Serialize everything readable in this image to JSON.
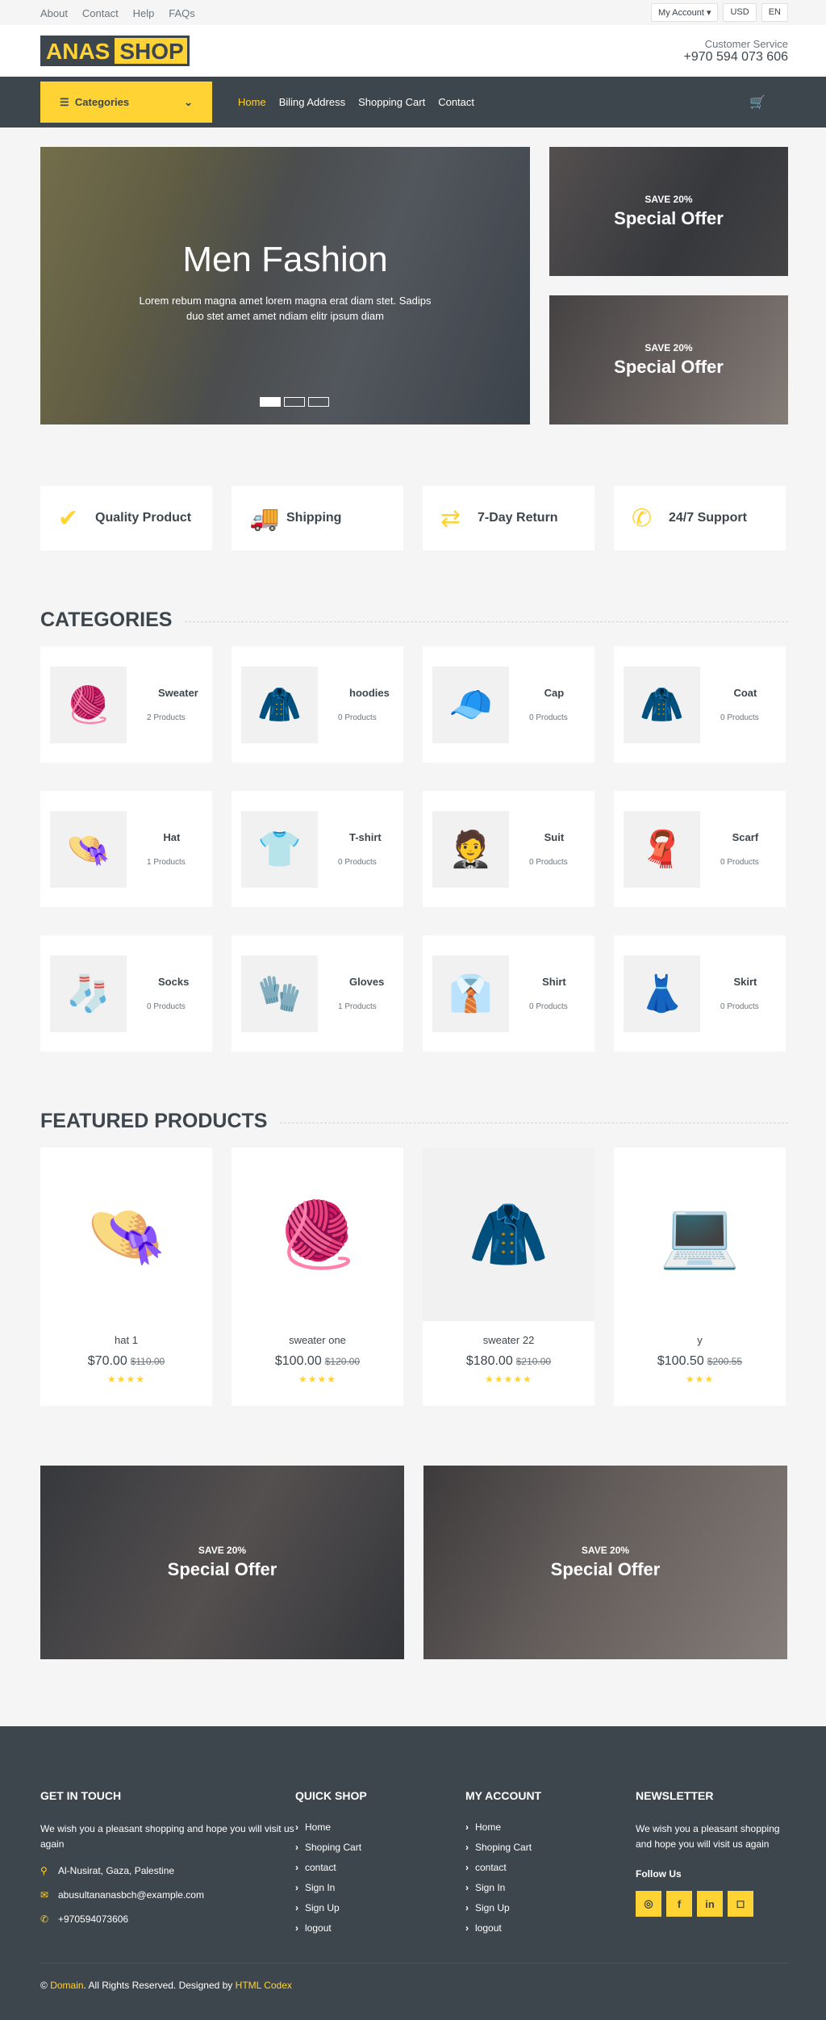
{
  "topbar": {
    "links": [
      "About",
      "Contact",
      "Help",
      "FAQs"
    ],
    "account": "My Account",
    "currency": "USD",
    "language": "EN"
  },
  "header": {
    "logo_a": "ANAS",
    "logo_b": "SHOP",
    "cs_label": "Customer Service",
    "cs_phone": "+970 594 073 606"
  },
  "nav": {
    "categories": "Categories",
    "links": [
      "Home",
      "Biling Address",
      "Shopping Cart",
      "Contact"
    ]
  },
  "hero": {
    "title": "Men Fashion",
    "text": "Lorem rebum magna amet lorem magna erat diam stet. Sadips duo stet amet amet ndiam elitr ipsum diam",
    "offer_save": "SAVE 20%",
    "offer_title": "Special Offer"
  },
  "features": [
    "Quality Product",
    "Shipping",
    "7-Day Return",
    "24/7 Support"
  ],
  "categories_title": "Categories",
  "categories": [
    {
      "name": "Sweater",
      "count": "2 Products",
      "icon": "🧶"
    },
    {
      "name": "hoodies",
      "count": "0 Products",
      "icon": "🧥"
    },
    {
      "name": "Cap",
      "count": "0 Products",
      "icon": "🧢"
    },
    {
      "name": "Coat",
      "count": "0 Products",
      "icon": "🧥"
    },
    {
      "name": "Hat",
      "count": "1 Products",
      "icon": "👒"
    },
    {
      "name": "T-shirt",
      "count": "0 Products",
      "icon": "👕"
    },
    {
      "name": "Suit",
      "count": "0 Products",
      "icon": "🤵"
    },
    {
      "name": "Scarf",
      "count": "0 Products",
      "icon": "🧣"
    },
    {
      "name": "Socks",
      "count": "0 Products",
      "icon": "🧦"
    },
    {
      "name": "Gloves",
      "count": "1 Products",
      "icon": "🧤"
    },
    {
      "name": "Shirt",
      "count": "0 Products",
      "icon": "👔"
    },
    {
      "name": "Skirt",
      "count": "0 Products",
      "icon": "👗"
    }
  ],
  "featured_title": "Featured Products",
  "products": [
    {
      "name": "hat 1",
      "price": "$70.00",
      "old": "$110.00",
      "stars": "★★★★",
      "icon": "👒"
    },
    {
      "name": "sweater one",
      "price": "$100.00",
      "old": "$120.00",
      "stars": "★★★★",
      "icon": "🧶"
    },
    {
      "name": "sweater 22",
      "price": "$180.00",
      "old": "$210.00",
      "stars": "★★★★★",
      "icon": "🧥"
    },
    {
      "name": "y",
      "price": "$100.50",
      "old": "$200.55",
      "stars": "★★★",
      "icon": "💻"
    }
  ],
  "footer": {
    "touch_title": "Get In Touch",
    "touch_text": "We wish you a pleasant shopping and hope you will visit us again",
    "address": "Al-Nusirat, Gaza, Palestine",
    "email": "abusultananasbch@example.com",
    "phone": "+970594073606",
    "quick_title": "Quick Shop",
    "quick_links": [
      "Home",
      "Shoping Cart",
      "contact",
      "Sign In",
      "Sign Up",
      "logout"
    ],
    "account_title": "My Account",
    "account_links": [
      "Home",
      "Shoping Cart",
      "contact",
      "Sign In",
      "Sign Up",
      "logout"
    ],
    "news_title": "Newsletter",
    "news_text": "We wish you a pleasant shopping and hope you will visit us again",
    "follow": "Follow Us",
    "copy_domain": "Domain",
    "copy_mid": ". All Rights Reserved. Designed by",
    "copy_by": "HTML Codex"
  }
}
